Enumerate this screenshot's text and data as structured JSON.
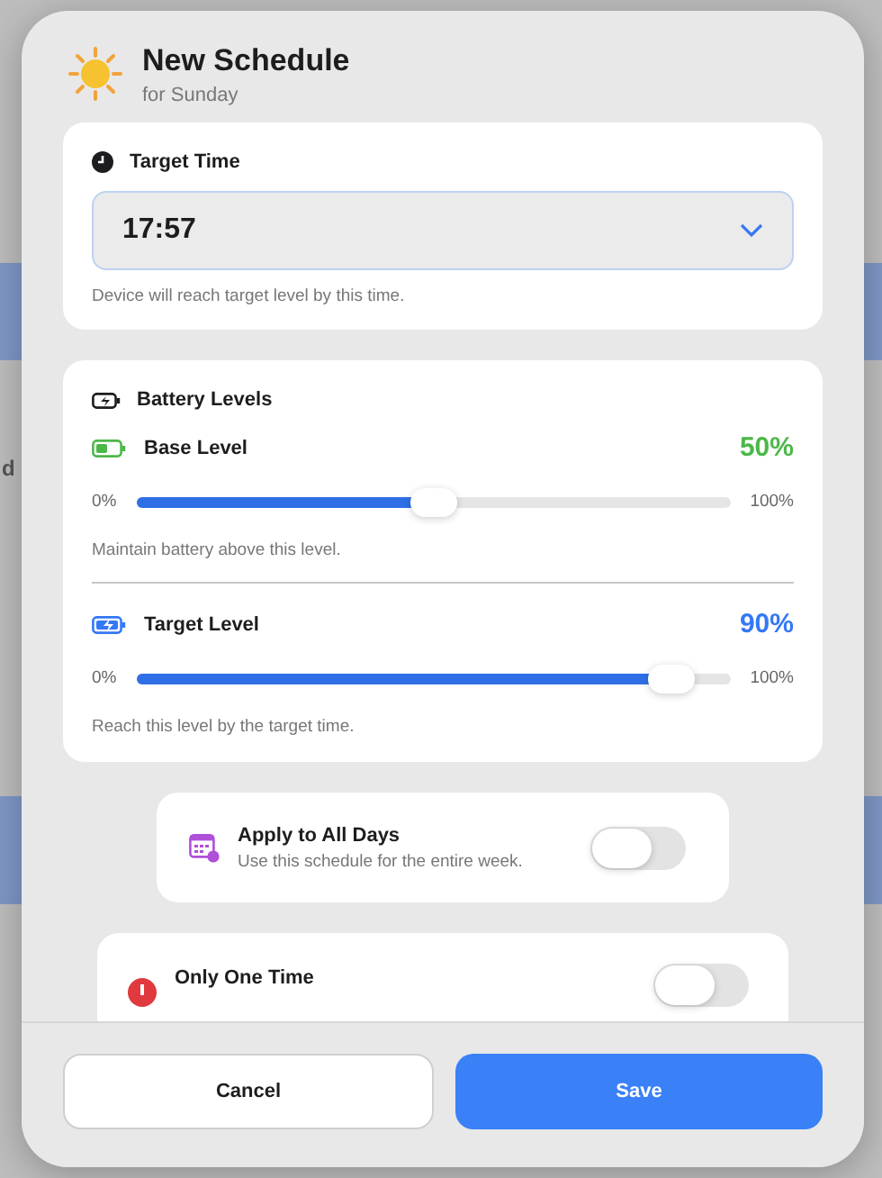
{
  "backdrop": {
    "text": "d"
  },
  "header": {
    "title": "New Schedule",
    "subtitle": "for Sunday"
  },
  "target_time": {
    "title": "Target Time",
    "value": "17:57",
    "hint": "Device will reach target level by this time."
  },
  "battery_levels": {
    "title": "Battery Levels",
    "sliders": [
      {
        "kind": "base",
        "label": "Base Level",
        "reading": "50%",
        "color": "#4cb749",
        "level": 0.5,
        "min_label": "0%",
        "max_label": "100%",
        "hint": "Maintain battery above this level."
      },
      {
        "kind": "target",
        "label": "Target Level",
        "reading": "90%",
        "color": "#3478f6",
        "level": 0.9,
        "min_label": "0%",
        "max_label": "100%",
        "hint": "Reach this level by the target time."
      }
    ]
  },
  "options": [
    {
      "kind": "calendar",
      "title": "Apply to All Days",
      "subtitle": "Use this schedule for the entire week.",
      "on": false
    },
    {
      "kind": "alert",
      "title": "Only One Time",
      "on": false
    }
  ],
  "buttons": [
    {
      "kind": "secondary",
      "label": "Cancel"
    },
    {
      "kind": "primary",
      "label": "Save"
    }
  ]
}
